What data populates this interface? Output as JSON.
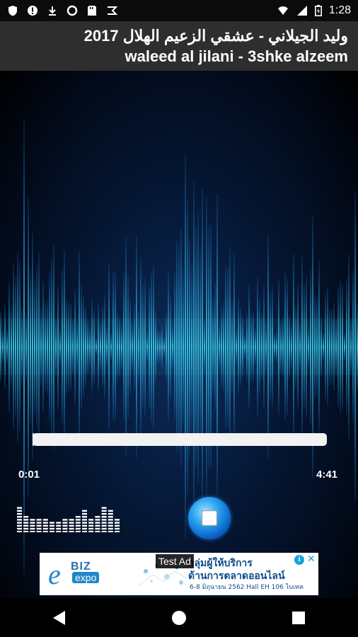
{
  "status_bar": {
    "time": "1:28",
    "left_icons": [
      "shield-icon",
      "alert-icon",
      "download-icon",
      "circle-icon",
      "sdcard-icon",
      "flag-icon"
    ],
    "right_icons": [
      "wifi-icon",
      "signal-icon",
      "battery-icon"
    ]
  },
  "header": {
    "title_arabic": "وليد الجيلاني - عشقي الزعيم الهلال 2017",
    "title_latin": "waleed al jilani - 3shke alzeem"
  },
  "player": {
    "elapsed": "0:01",
    "duration": "4:41",
    "progress_fraction": 0.004
  },
  "ad": {
    "badge": "Test Ad",
    "brand_letter": "e",
    "brand_biz": "BIZ",
    "brand_expo": "expo",
    "line1": "กลุ่มผู้ให้บริการ",
    "line2": "ด้านการตลาดออนไลน์",
    "line3": "6-8 มิถุนายน 2562  Hall EH 106 ไบเทค"
  },
  "colors": {
    "wave_cyan": "#39c6e6",
    "wave_blue": "#1a78c8",
    "title_bg": "#2e2e2e",
    "stop_blue": "#2aa4f0"
  }
}
